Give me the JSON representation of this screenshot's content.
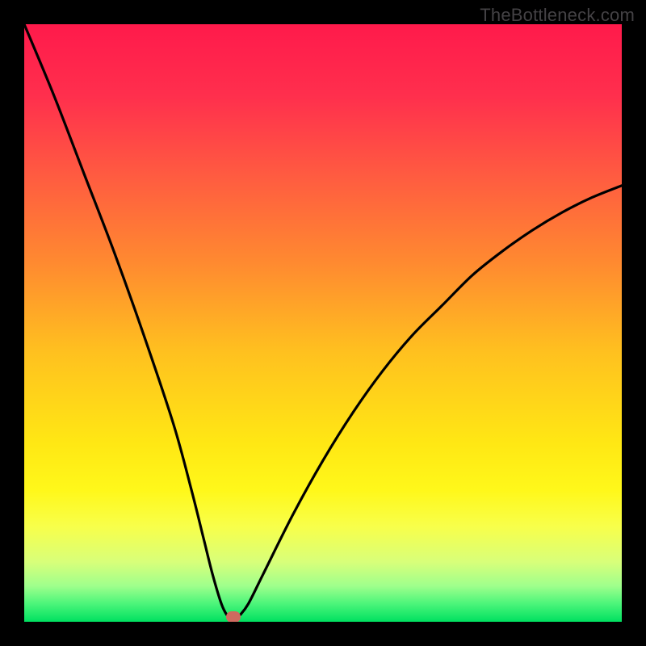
{
  "watermark": "TheBottleneck.com",
  "chart_data": {
    "type": "line",
    "title": "",
    "xlabel": "",
    "ylabel": "",
    "xlim": [
      0,
      100
    ],
    "ylim": [
      0,
      100
    ],
    "series": [
      {
        "name": "bottleneck-curve",
        "x": [
          0,
          5,
          10,
          15,
          20,
          25,
          28,
          30,
          31.5,
          33,
          34,
          35,
          36,
          37.5,
          40,
          45,
          50,
          55,
          60,
          65,
          70,
          75,
          80,
          85,
          90,
          95,
          100
        ],
        "values": [
          100,
          88,
          75,
          62,
          48,
          33,
          22,
          14,
          8,
          3,
          1,
          0,
          1,
          3,
          8,
          18,
          27,
          35,
          42,
          48,
          53,
          58,
          62,
          65.5,
          68.5,
          71,
          73
        ]
      }
    ],
    "marker": {
      "x": 35,
      "y": 0
    },
    "gradient_stops": [
      {
        "offset": 0.0,
        "color": "#ff1a4b"
      },
      {
        "offset": 0.12,
        "color": "#ff2f4d"
      },
      {
        "offset": 0.25,
        "color": "#ff5a41"
      },
      {
        "offset": 0.4,
        "color": "#ff8a30"
      },
      {
        "offset": 0.55,
        "color": "#ffc11f"
      },
      {
        "offset": 0.7,
        "color": "#ffe714"
      },
      {
        "offset": 0.78,
        "color": "#fff81a"
      },
      {
        "offset": 0.84,
        "color": "#f8ff4a"
      },
      {
        "offset": 0.9,
        "color": "#d8ff7a"
      },
      {
        "offset": 0.94,
        "color": "#9fff8c"
      },
      {
        "offset": 0.97,
        "color": "#4bf57a"
      },
      {
        "offset": 1.0,
        "color": "#00e060"
      }
    ]
  }
}
